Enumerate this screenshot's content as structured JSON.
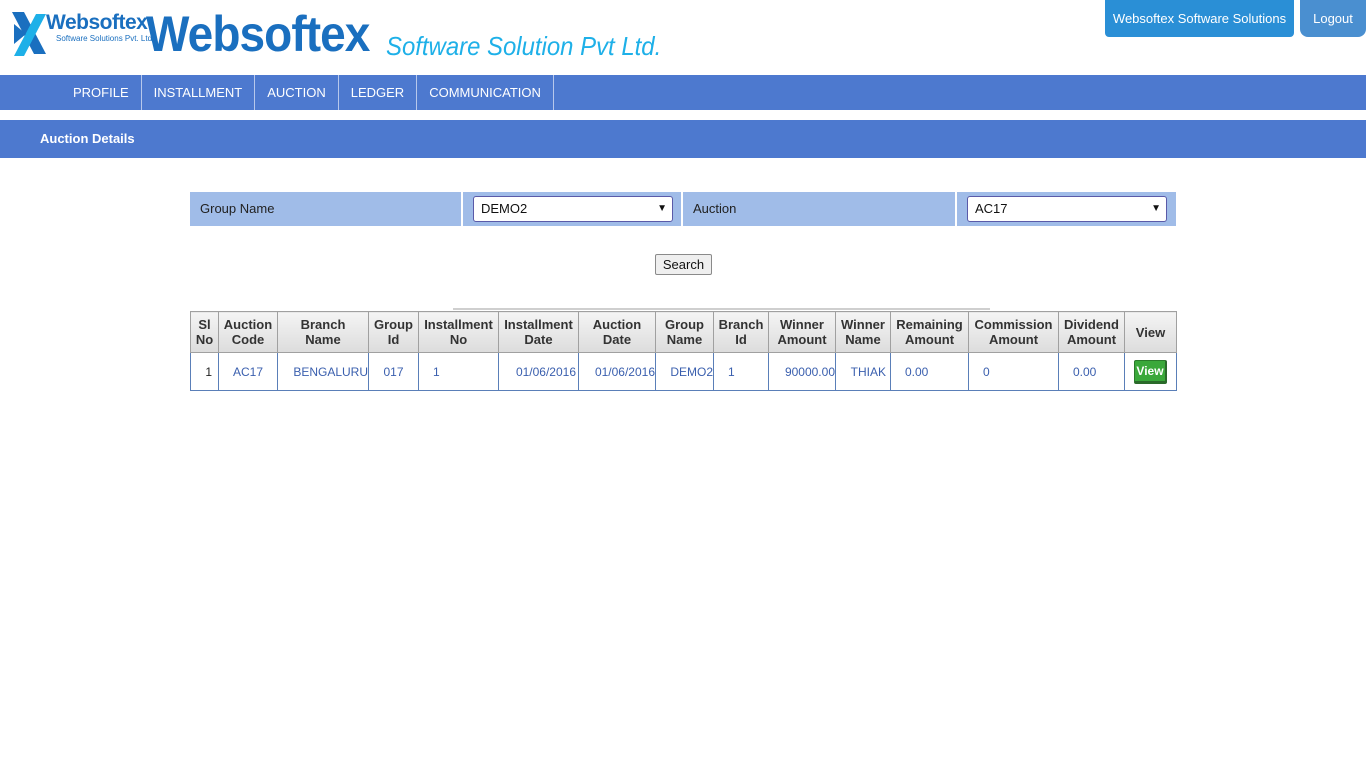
{
  "header": {
    "logo_name": "Websoftex",
    "logo_sub": "Software Solutions Pvt. Ltd.",
    "brand": "Websoftex",
    "tagline": "Software Solution Pvt Ltd.",
    "company_button": "Websoftex Software Solutions",
    "logout_button": "Logout"
  },
  "nav": {
    "items": [
      {
        "label": "PROFILE"
      },
      {
        "label": "INSTALLMENT"
      },
      {
        "label": "AUCTION"
      },
      {
        "label": "LEDGER"
      },
      {
        "label": "COMMUNICATION"
      }
    ]
  },
  "page": {
    "title": "Auction Details"
  },
  "filter": {
    "group_label": "Group Name",
    "group_value": "DEMO2",
    "auction_label": "Auction",
    "auction_value": "AC17",
    "search_label": "Search"
  },
  "table": {
    "headers": [
      {
        "l1": "Sl",
        "l2": "No"
      },
      {
        "l1": "Auction",
        "l2": "Code"
      },
      {
        "l1": "Branch",
        "l2": "Name"
      },
      {
        "l1": "Group",
        "l2": "Id"
      },
      {
        "l1": "Installment",
        "l2": "No"
      },
      {
        "l1": "Installment",
        "l2": "Date"
      },
      {
        "l1": "Auction",
        "l2": "Date"
      },
      {
        "l1": "Group",
        "l2": "Name"
      },
      {
        "l1": "Branch",
        "l2": "Id"
      },
      {
        "l1": "Winner",
        "l2": "Amount"
      },
      {
        "l1": "Winner",
        "l2": "Name"
      },
      {
        "l1": "Remaining",
        "l2": "Amount"
      },
      {
        "l1": "Commission",
        "l2": "Amount"
      },
      {
        "l1": "Dividend",
        "l2": "Amount"
      },
      {
        "l1": "View",
        "l2": ""
      }
    ],
    "rows": [
      {
        "sl_no": "1",
        "auction_code": "AC17",
        "branch_name": "BENGALURU",
        "group_id": "017",
        "installment_no": "1",
        "installment_date": "01/06/2016",
        "auction_date": "01/06/2016",
        "group_name": "DEMO2",
        "branch_id": "1",
        "winner_amount": "90000.00",
        "winner_name": "THIAK",
        "remaining_amount": "0.00",
        "commission_amount": "0",
        "dividend_amount": "0.00",
        "view_label": "View"
      }
    ]
  },
  "colors": {
    "nav_bg": "#4d79cf",
    "filter_bg": "#a0bce8",
    "brand_blue": "#1a6fbf",
    "brand_cyan": "#1eb0e8",
    "view_green": "#3aa83a"
  }
}
